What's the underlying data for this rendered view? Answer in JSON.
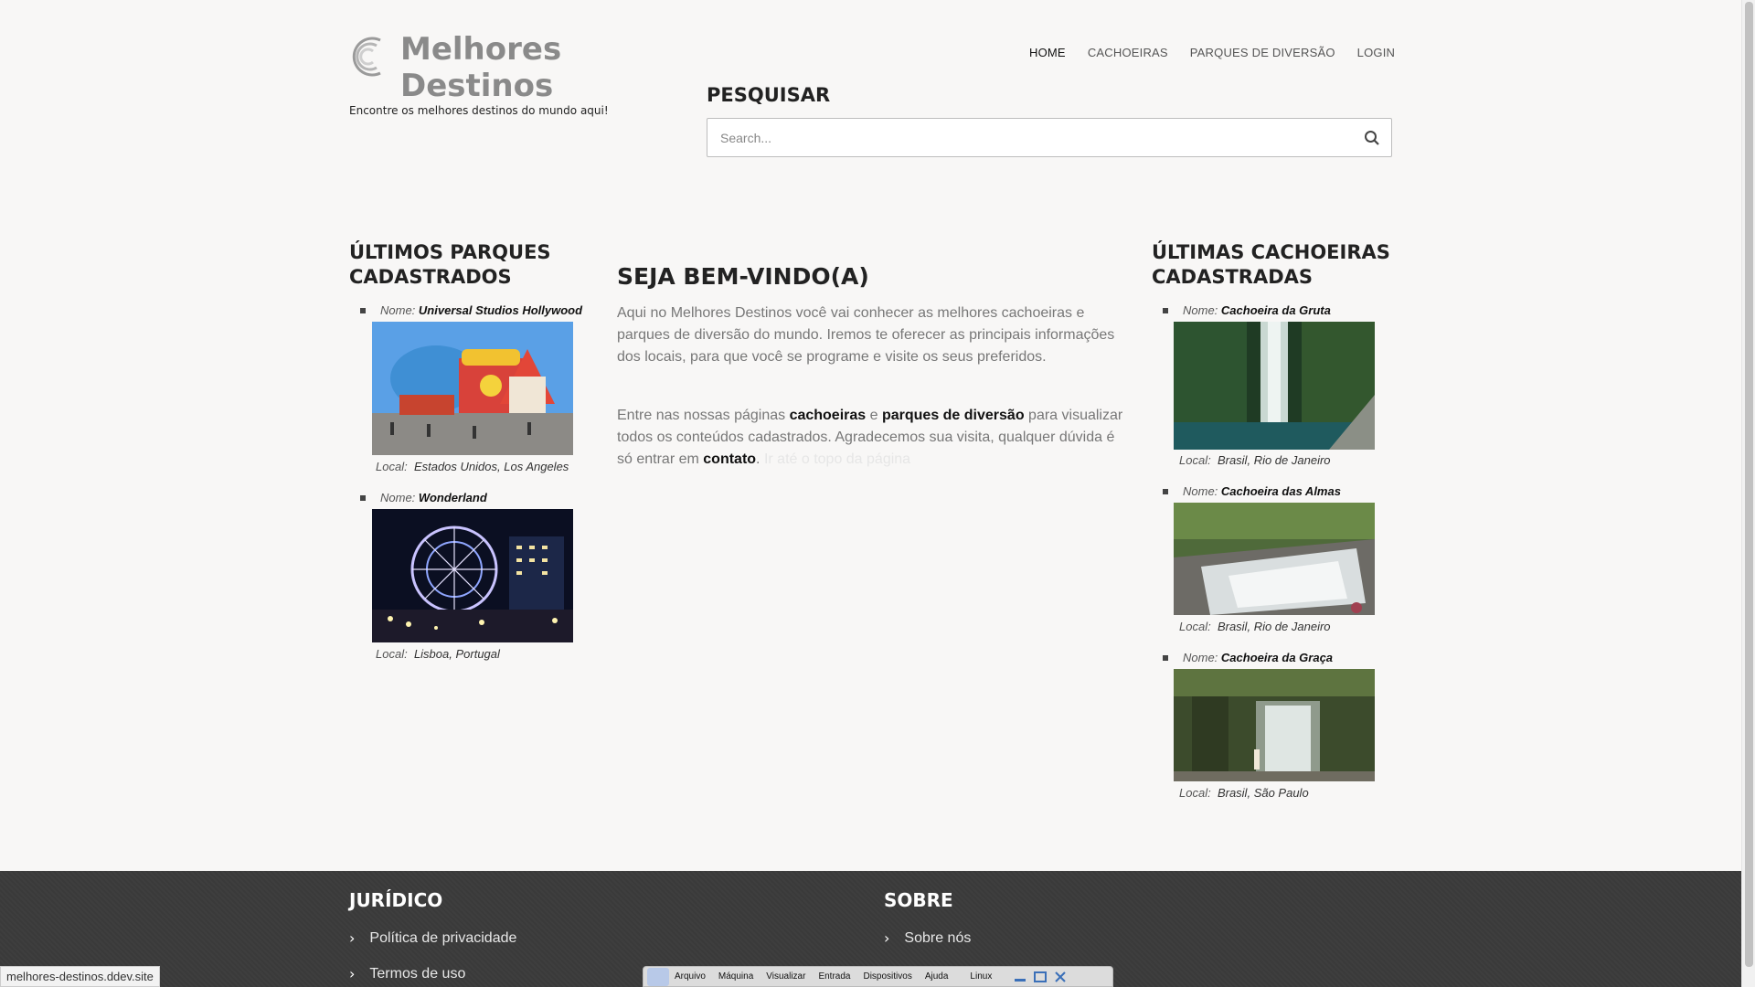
{
  "site": {
    "title": "Melhores Destinos",
    "tagline": "Encontre os melhores destinos do mundo aqui!"
  },
  "nav": [
    {
      "label": "HOME",
      "active": true
    },
    {
      "label": "CACHOEIRAS",
      "active": false
    },
    {
      "label": "PARQUES DE DIVERSÃO",
      "active": false
    },
    {
      "label": "LOGIN",
      "active": false
    }
  ],
  "search": {
    "title": "PESQUISAR",
    "placeholder": "Search..."
  },
  "left": {
    "title": "ÚLTIMOS PARQUES CADASTRADOS",
    "items": [
      {
        "name_label": "Nome:",
        "name": "Universal Studios Hollywood",
        "local_label": "Local:",
        "country": "Estados Unidos",
        "city": "Los Angeles"
      },
      {
        "name_label": "Nome:",
        "name": "Wonderland",
        "local_label": "Local:",
        "country": "Lisboa",
        "city": "Portugal"
      }
    ]
  },
  "right": {
    "title": "ÚLTIMAS CACHOEIRAS CADASTRADAS",
    "items": [
      {
        "name_label": "Nome:",
        "name": "Cachoeira da Gruta",
        "local_label": "Local:",
        "country": "Brasil",
        "city": "Rio de Janeiro"
      },
      {
        "name_label": "Nome:",
        "name": "Cachoeira das Almas",
        "local_label": "Local:",
        "country": "Brasil",
        "city": "Rio de Janeiro"
      },
      {
        "name_label": "Nome:",
        "name": "Cachoeira da Graça",
        "local_label": "Local:",
        "country": "Brasil",
        "city": "São Paulo"
      }
    ]
  },
  "welcome": {
    "title": "SEJA BEM-VINDO(A)",
    "p1": "Aqui no Melhores Destinos você vai conhecer as melhores cachoeiras e parques de diversão do mundo. Iremos te oferecer as principais informações dos locais, para que você se programe e visite os seus preferidos.",
    "p2_a": "Entre nas nossas páginas ",
    "p2_link1": "cachoeiras",
    "p2_b": " e ",
    "p2_link2": "parques de diversão",
    "p2_c": " para visualizar todos os conteúdos cadastrados. Agradecemos sua visita, qualquer dúvida é só entrar em ",
    "p2_link3": "contato",
    "p2_d": ".",
    "p2_faded": " Ir até o topo da página"
  },
  "footer": {
    "col1_title": "JURÍDICO",
    "col1_links": [
      "Política de privacidade",
      "Termos de uso"
    ],
    "col2_title": "SOBRE",
    "col2_links": [
      "Sobre nós"
    ]
  },
  "status_url": "melhores-destinos.ddev.site",
  "vm_bar": {
    "items": [
      "Arquivo",
      "Máquina",
      "Visualizar",
      "Entrada",
      "Dispositivos",
      "Ajuda"
    ],
    "os": "Linux"
  },
  "colors": {
    "background": "#f8f7f6",
    "footer": "#3a3a3a",
    "logo_text": "#8a8a8a"
  }
}
